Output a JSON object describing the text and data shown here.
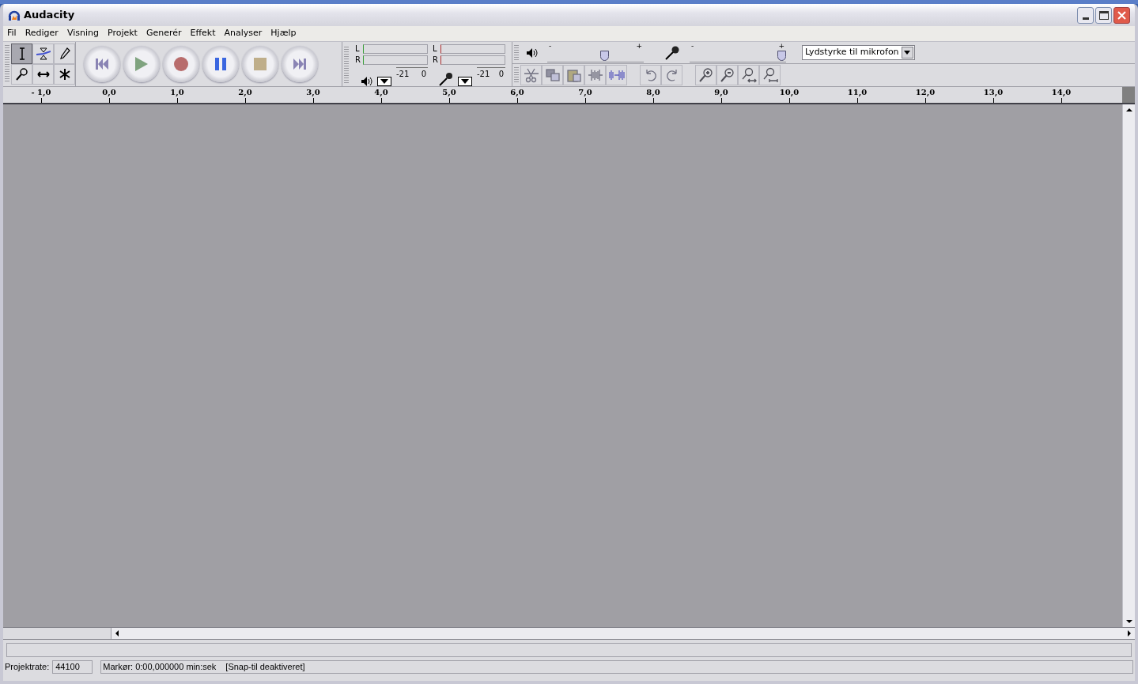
{
  "window": {
    "title": "Audacity"
  },
  "menu": [
    "Fil",
    "Rediger",
    "Visning",
    "Projekt",
    "Generér",
    "Effekt",
    "Analyser",
    "Hjælp"
  ],
  "tools": [
    {
      "kind": "select",
      "selected": true
    },
    {
      "kind": "envelope",
      "selected": false
    },
    {
      "kind": "draw",
      "selected": false
    },
    {
      "kind": "zoom",
      "selected": false
    },
    {
      "kind": "timeshift",
      "selected": false
    },
    {
      "kind": "multi",
      "selected": false
    }
  ],
  "transport": [
    {
      "kind": "skip-start"
    },
    {
      "kind": "play"
    },
    {
      "kind": "record"
    },
    {
      "kind": "pause"
    },
    {
      "kind": "stop"
    },
    {
      "kind": "skip-end"
    }
  ],
  "meters": [
    {
      "kind": "output",
      "channels": [
        "L",
        "R"
      ],
      "scale": [
        "-21",
        "0"
      ]
    },
    {
      "kind": "input",
      "channels": [
        "L",
        "R"
      ],
      "scale": [
        "-21",
        "0"
      ]
    }
  ],
  "mixer": [
    {
      "kind": "output",
      "min": "-",
      "max": "+",
      "level": 0.6
    },
    {
      "kind": "input",
      "min": "-",
      "max": "+",
      "level": 1
    }
  ],
  "input_source": "Lydstyrke til mikrofon",
  "edit_tools": [
    {
      "kind": "cut"
    },
    {
      "kind": "copy"
    },
    {
      "kind": "paste"
    },
    {
      "kind": "trim"
    },
    {
      "kind": "silence"
    },
    {
      "kind": "undo"
    },
    {
      "kind": "redo"
    },
    {
      "kind": "zoom-in"
    },
    {
      "kind": "zoom-out"
    },
    {
      "kind": "fit-selection"
    },
    {
      "kind": "fit-project"
    }
  ],
  "ruler": [
    "- 1,0",
    "0,0",
    "1,0",
    "2,0",
    "3,0",
    "4,0",
    "5,0",
    "6,0",
    "7,0",
    "8,0",
    "9,0",
    "10,0",
    "11,0",
    "12,0",
    "13,0",
    "14,0"
  ],
  "status": {
    "rate_label": "Projektrate:",
    "rate": "44100",
    "cursor": "Markør: 0:00,000000 min:sek",
    "snap": "[Snap-til deaktiveret]"
  }
}
